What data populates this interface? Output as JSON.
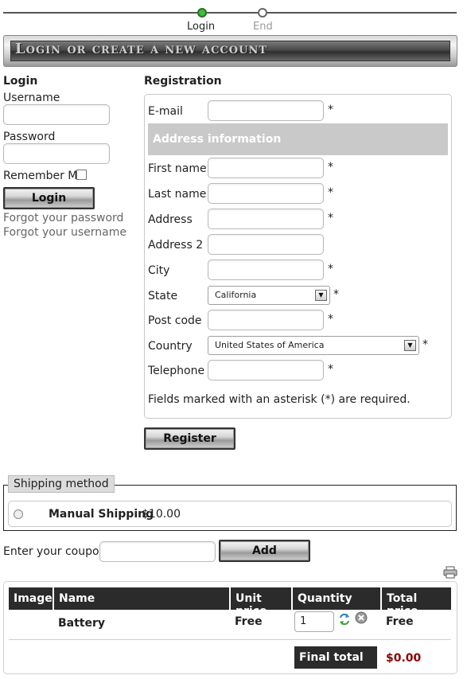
{
  "progress": {
    "steps": [
      {
        "label": "Login",
        "active": true
      },
      {
        "label": "End",
        "active": false
      }
    ]
  },
  "header": {
    "title": "Login or create a new account"
  },
  "login": {
    "heading": "Login",
    "username_label": "Username",
    "username_value": "",
    "password_label": "Password",
    "password_value": "",
    "remember_label": "Remember Me",
    "remember_checked": false,
    "login_button": "Login",
    "forgot_password": "Forgot your password",
    "forgot_username": "Forgot your username"
  },
  "registration": {
    "heading": "Registration",
    "email_label": "E-mail",
    "address_section": "Address information",
    "first_name_label": "First name",
    "last_name_label": "Last name",
    "address_label": "Address",
    "address2_label": "Address 2",
    "city_label": "City",
    "state_label": "State",
    "state_value": "California",
    "post_code_label": "Post code",
    "country_label": "Country",
    "country_value": "United States of America",
    "telephone_label": "Telephone",
    "required_star": "*",
    "required_note": "Fields marked with an asterisk (*) are required.",
    "register_button": "Register"
  },
  "shipping": {
    "legend": "Shipping method",
    "method_name": "Manual Shipping",
    "method_price": "$10.00",
    "selected": false
  },
  "coupon": {
    "label": "Enter your coupon",
    "value": "",
    "add_button": "Add"
  },
  "cart": {
    "columns": [
      "Image",
      "Name",
      "Unit price",
      "Quantity",
      "Total price"
    ],
    "rows": [
      {
        "name": "Battery",
        "unit_price": "Free",
        "quantity": "1",
        "total": "Free"
      }
    ],
    "final_total_label": "Final total",
    "final_total_value": "$0.00",
    "total_color": "#8b0000"
  },
  "icons": {
    "print": "printer-icon",
    "refresh": "refresh-icon",
    "remove": "remove-icon",
    "dropdown": "chevron-down-icon"
  }
}
